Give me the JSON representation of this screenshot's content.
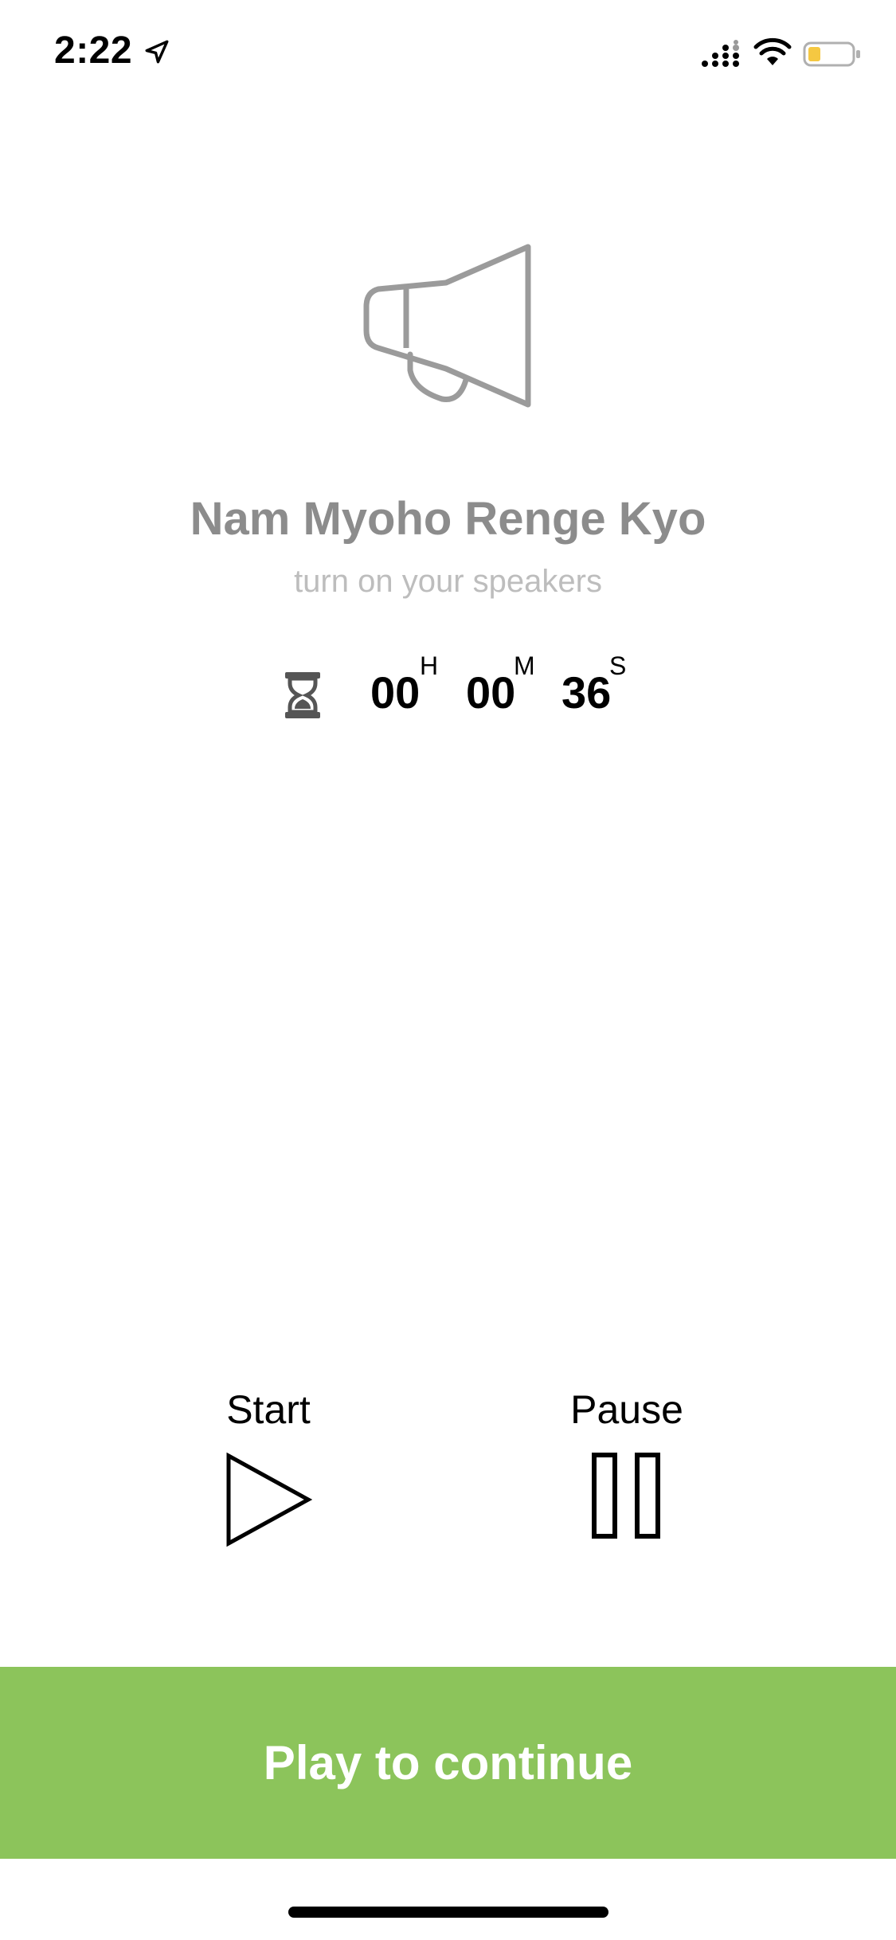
{
  "status_bar": {
    "time": "2:22"
  },
  "main": {
    "title": "Nam Myoho Renge Kyo",
    "subtitle": "turn on your speakers"
  },
  "timer": {
    "hours": "00",
    "hours_unit": "H",
    "minutes": "00",
    "minutes_unit": "M",
    "seconds": "36",
    "seconds_unit": "S"
  },
  "controls": {
    "start_label": "Start",
    "pause_label": "Pause"
  },
  "footer": {
    "continue_label": "Play to continue"
  },
  "colors": {
    "accent_green": "#8cc45b",
    "title_gray": "#8c8c8c",
    "subtitle_gray": "#bdbdbd",
    "battery_yellow": "#f5c842"
  },
  "icons": {
    "location": "location-arrow-icon",
    "signal": "signal-icon",
    "wifi": "wifi-icon",
    "battery": "battery-icon",
    "megaphone": "megaphone-icon",
    "hourglass": "hourglass-icon",
    "play": "play-icon",
    "pause": "pause-icon"
  }
}
